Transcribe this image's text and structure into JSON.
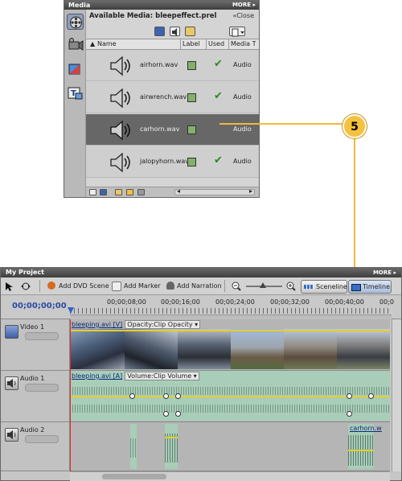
{
  "media_panel": {
    "title": "Media",
    "more": "MORE",
    "available_label": "Available Media: bleepeffect.prel",
    "close_label": "Close",
    "columns": {
      "name": "Name",
      "label": "Label",
      "used": "Used",
      "media_type": "Media T"
    },
    "items": [
      {
        "name": "airhorn.wav",
        "used": "✔",
        "type": "Audio"
      },
      {
        "name": "airwrench.wav",
        "used": "✔",
        "type": "Audio"
      },
      {
        "name": "carhorn.wav",
        "used": "",
        "type": "Audio"
      },
      {
        "name": "jalopyhorn.wav",
        "used": "✔",
        "type": "Audio"
      }
    ]
  },
  "callout": {
    "number": "5"
  },
  "project_panel": {
    "title": "My Project",
    "more": "MORE",
    "toolbar": {
      "add_dvd_scene": "Add DVD Scene",
      "add_marker": "Add Marker",
      "add_narration": "Add Narration",
      "sceneline": "Sceneline",
      "timeline": "Timeline"
    },
    "timecode": "00;00;00;00",
    "ruler_labels": [
      "00;00;08;00",
      "00;00;16;00",
      "00;00;24;00",
      "00;00;32;00",
      "00;00;40;00",
      "00;0"
    ],
    "tracks": {
      "video1": {
        "name": "Video 1",
        "clip_label": "bleeping.avi [V]",
        "effect": "Opacity:Clip Opacity"
      },
      "audio1": {
        "name": "Audio 1",
        "clip_label": "bleeping.avi [A]",
        "effect": "Volume:Clip Volume"
      },
      "audio2": {
        "name": "Audio 2",
        "clip_label": "carhorn.w"
      }
    }
  },
  "colors": {
    "callout": "#f4c23e",
    "selected_row": "#676767",
    "audio_clip": "#a8cdb9",
    "playhead": "#e02b2b"
  }
}
